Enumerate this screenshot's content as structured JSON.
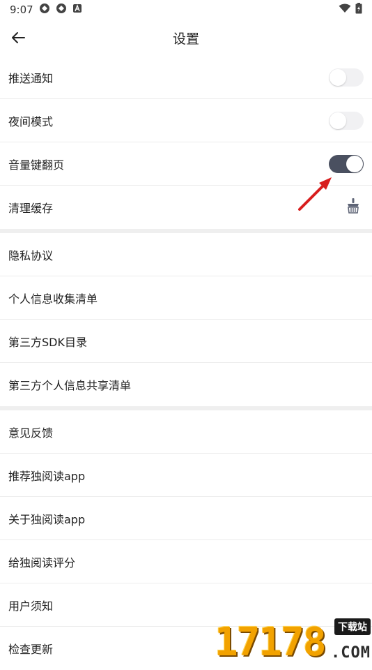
{
  "status": {
    "time": "9:07"
  },
  "header": {
    "title": "设置"
  },
  "sections": [
    {
      "items": [
        {
          "label": "推送通知",
          "control": "toggle",
          "on": false
        },
        {
          "label": "夜间模式",
          "control": "toggle",
          "on": false
        },
        {
          "label": "音量键翻页",
          "control": "toggle",
          "on": true
        },
        {
          "label": "清理缓存",
          "control": "icon",
          "icon": "broom-icon"
        }
      ]
    },
    {
      "items": [
        {
          "label": "隐私协议"
        },
        {
          "label": "个人信息收集清单"
        },
        {
          "label": "第三方SDK目录"
        },
        {
          "label": "第三方个人信息共享清单"
        }
      ]
    },
    {
      "items": [
        {
          "label": "意见反馈"
        },
        {
          "label": "推荐独阅读app"
        },
        {
          "label": "关于独阅读app"
        },
        {
          "label": "给独阅读评分"
        },
        {
          "label": "用户须知"
        },
        {
          "label": "检查更新"
        }
      ]
    }
  ],
  "watermark": {
    "digits": "17178",
    "badge": "下载站",
    "domain": ".COM"
  },
  "colors": {
    "toggle_on": "#4a5060",
    "toggle_off": "#f1f1f3",
    "annotation_arrow": "#d81e1e",
    "watermark": "#f2a200"
  }
}
